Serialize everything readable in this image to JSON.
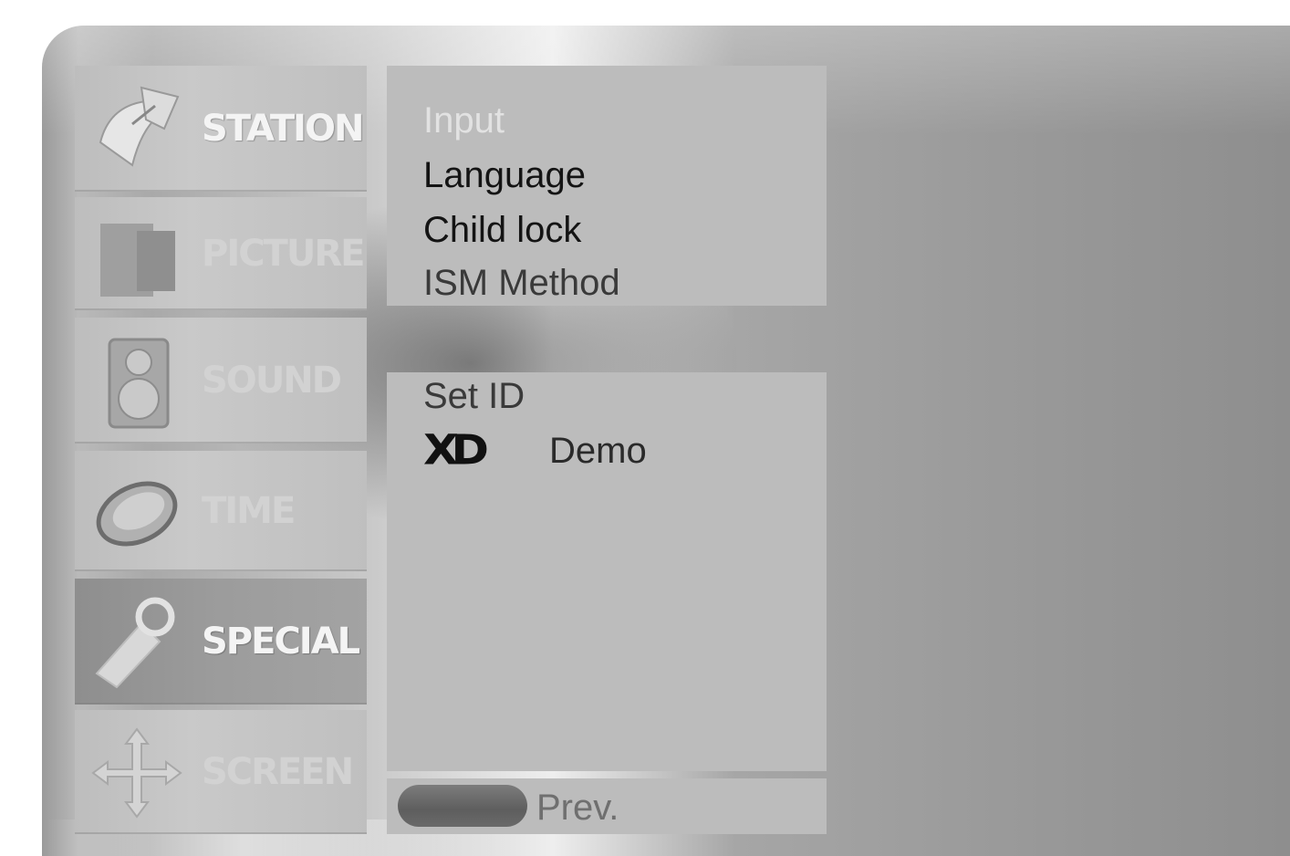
{
  "menu": {
    "tabs": [
      {
        "label": "STATION",
        "icon": "satellite-dish-icon"
      },
      {
        "label": "PICTURE",
        "icon": "picture-icon"
      },
      {
        "label": "SOUND",
        "icon": "speaker-icon"
      },
      {
        "label": "TIME",
        "icon": "clock-icon"
      },
      {
        "label": "SPECIAL",
        "icon": "tag-icon"
      },
      {
        "label": "SCREEN",
        "icon": "move-arrows-icon"
      }
    ],
    "active_tab": "SPECIAL"
  },
  "special_menu": {
    "items_top": [
      {
        "label": "Input"
      },
      {
        "label": "Language"
      },
      {
        "label": "Child lock"
      },
      {
        "label": "ISM Method"
      }
    ],
    "items_mid": {
      "set_id": "Set ID",
      "xd_logo": "XD",
      "xd_demo": "Demo"
    }
  },
  "footer": {
    "prev_label": "Prev."
  }
}
